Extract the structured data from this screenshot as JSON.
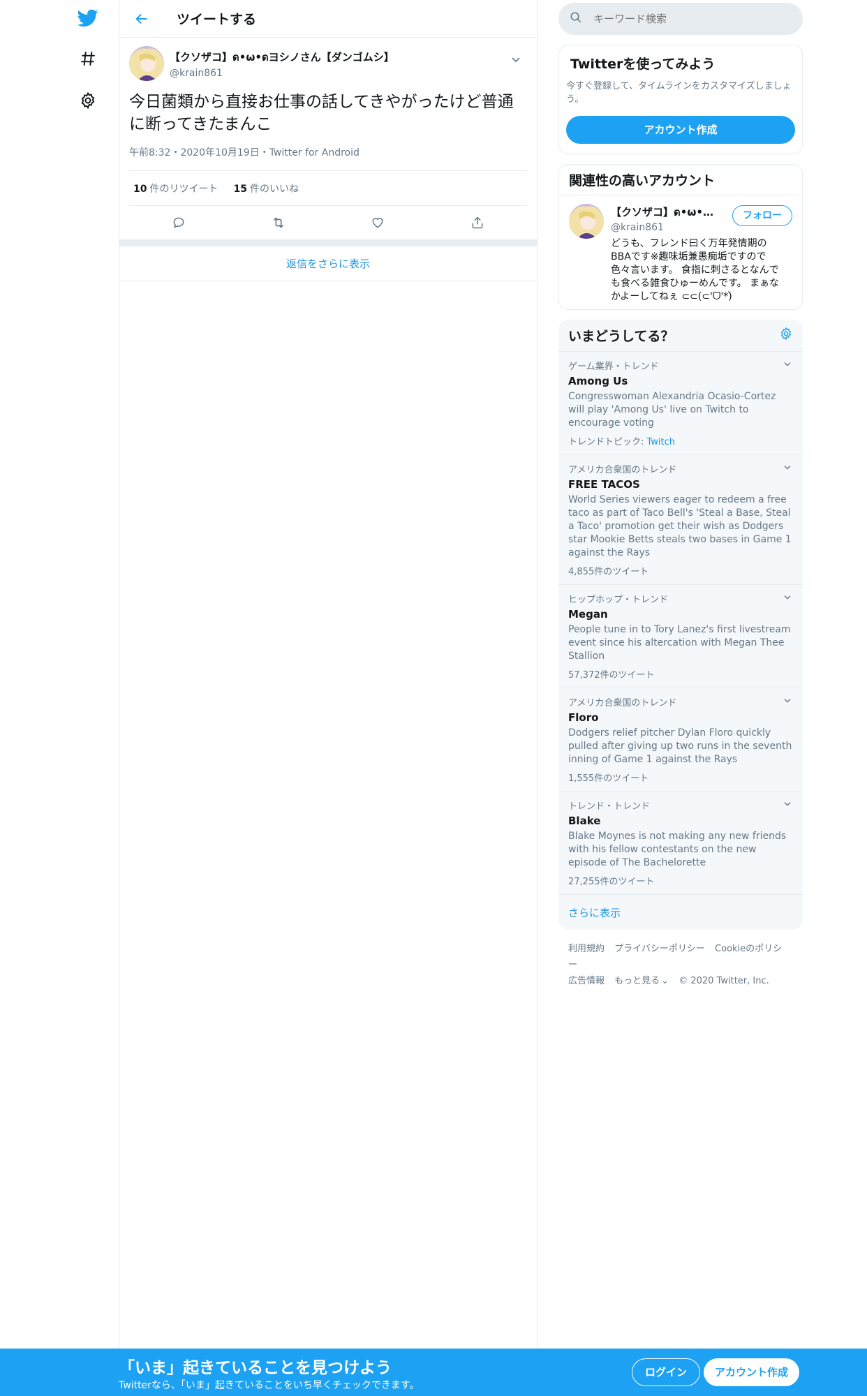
{
  "colors": {
    "accent": "#1da1f2",
    "link": "#1b95e0",
    "muted": "#657786",
    "border": "#e6ecf0"
  },
  "nav": {
    "icons": [
      "twitter-logo-icon",
      "hashtag-icon",
      "gear-icon"
    ]
  },
  "header": {
    "title": "ツイートする"
  },
  "tweet": {
    "author_name": "【クソザコ】ด•ω•ดヨシノさん【ダンゴムシ】",
    "author_handle": "@krain861",
    "text": "今日菌類から直接お仕事の話してきやがったけど普通に断ってきたまんこ",
    "meta": "午前8:32・2020年10月19日・Twitter for Android",
    "retweets_count": "10",
    "retweets_label": "件のリツイート",
    "likes_count": "15",
    "likes_label": "件のいいね"
  },
  "more_replies": "返信をさらに表示",
  "search": {
    "placeholder": "キーワード検索"
  },
  "signup_card": {
    "title": "Twitterを使ってみよう",
    "desc": "今すぐ登録して、タイムラインをカスタマイズしましょう。",
    "button": "アカウント作成"
  },
  "related": {
    "title": "関連性の高いアカウント",
    "name": "【クソザコ】ด•ω•ด...",
    "handle": "@krain861",
    "follow": "フォロー",
    "bio": "どうも、フレンド曰く万年発情期のBBAです※趣味垢兼愚痴垢ですので色々言います。 食指に刺さるとなんでも食べる雑食ひゅーめんです。 まぁなかよーしてねぇ ⊂⊂(⊂'ᗜ'*)̀̀"
  },
  "trends": {
    "title": "いまどうしてる？",
    "items": [
      {
        "context": "ゲーム業界・トレンド",
        "name": "Among Us",
        "desc": "Congresswoman Alexandria Ocasio-Cortez will play 'Among Us' live on Twitch to encourage voting",
        "footer_label": "トレンドトピック: ",
        "footer_link": "Twitch"
      },
      {
        "context": "アメリカ合衆国のトレンド",
        "name": "FREE TACOS",
        "desc": "World Series viewers eager to redeem a free taco as part of Taco Bell's 'Steal a Base, Steal a Taco' promotion get their wish as Dodgers star Mookie Betts steals two bases in Game 1 against the Rays",
        "count": "4,855件のツイート"
      },
      {
        "context": "ヒップホップ・トレンド",
        "name": "Megan",
        "desc": "People tune in to Tory Lanez's first livestream event since his altercation with Megan Thee Stallion",
        "count": "57,372件のツイート"
      },
      {
        "context": "アメリカ合衆国のトレンド",
        "name": "Floro",
        "desc": "Dodgers relief pitcher Dylan Floro quickly pulled after giving up two runs in the seventh inning of Game 1 against the Rays",
        "count": "1,555件のツイート"
      },
      {
        "context": "トレンド・トレンド",
        "name": "Blake",
        "desc": "Blake Moynes is not making any new friends with his fellow contestants on the new episode of The Bachelorette",
        "count": "27,255件のツイート"
      }
    ],
    "show_more": "さらに表示"
  },
  "footer": {
    "links": [
      "利用規約",
      "プライバシーポリシー",
      "Cookieのポリシー",
      "広告情報",
      "もっと見る"
    ],
    "copyright": "© 2020 Twitter, Inc."
  },
  "bottom_bar": {
    "title": "「いま」起きていることを見つけよう",
    "subtitle": "Twitterなら、「いま」起きていることをいち早くチェックできます。",
    "login": "ログイン",
    "signup": "アカウント作成"
  }
}
